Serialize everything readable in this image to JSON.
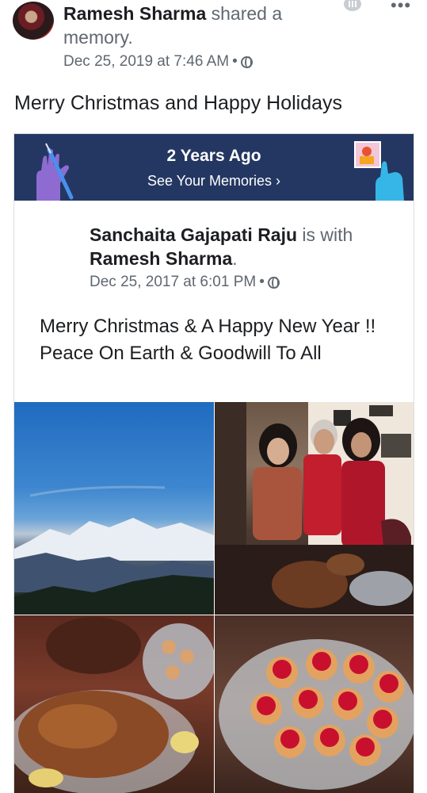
{
  "post": {
    "author": "Ramesh Sharma",
    "action": " shared a memory.",
    "timestamp": "Dec 25, 2019 at 7:46 AM",
    "separator": " •",
    "text": "Merry Christmas and Happy Holidays",
    "more": "•••"
  },
  "memory": {
    "banner_title": "2 Years Ago",
    "banner_link": "See Your Memories ›",
    "banner_color": "#243762"
  },
  "inner_post": {
    "author": "Sanchaita Gajapati Raju",
    "is_with": " is with ",
    "tagged": "Ramesh Sharma",
    "period": ".",
    "timestamp": "Dec 25, 2017 at 6:01 PM",
    "separator": " •",
    "text": "Merry Christmas & A Happy New Year !! Peace On Earth & Goodwill To All"
  },
  "photos": {
    "count": 4,
    "items": [
      "mountain-landscape",
      "family-group",
      "roast-dinner",
      "strawberry-tarts"
    ]
  }
}
